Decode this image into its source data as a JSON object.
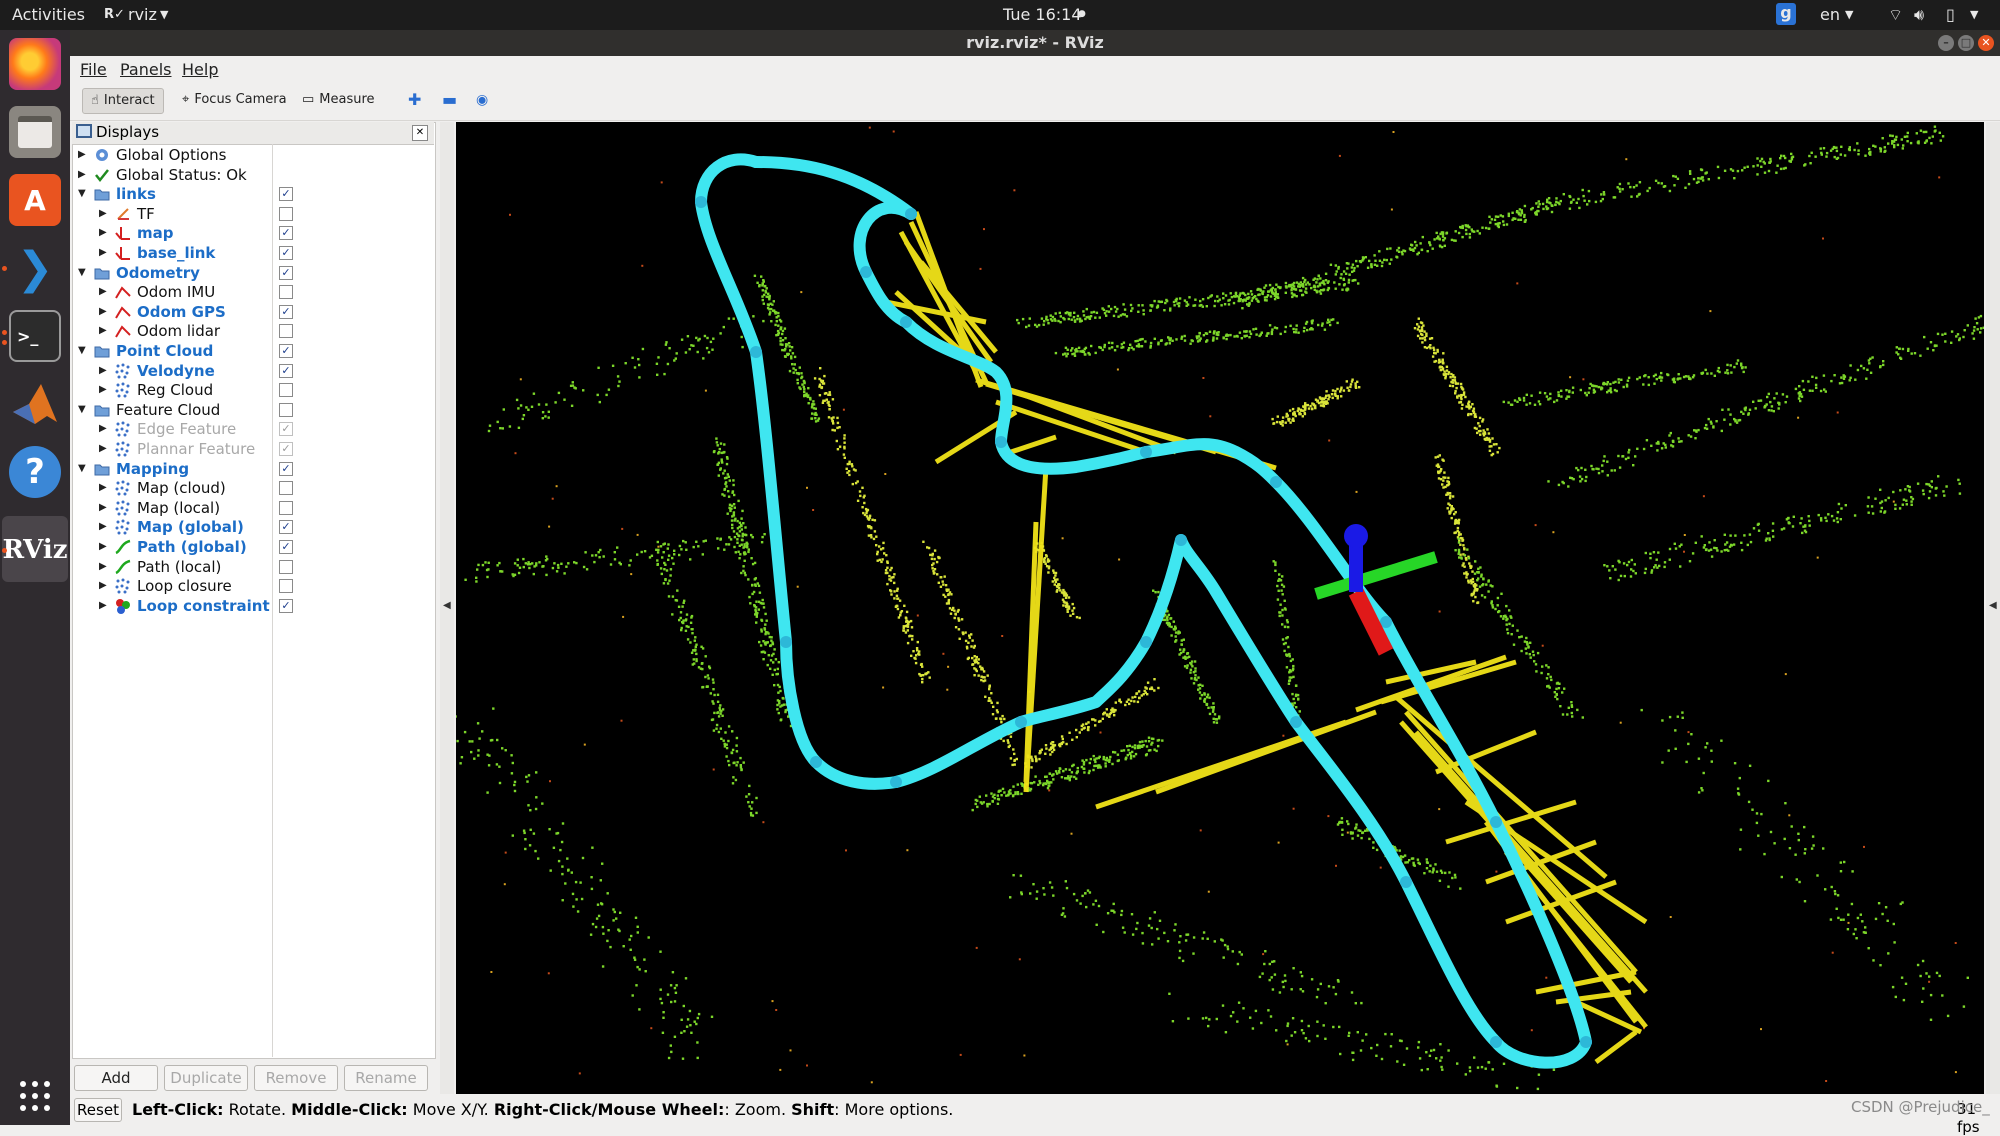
{
  "topbar": {
    "activities": "Activities",
    "app_name": "rviz",
    "clock": "Tue 16:14",
    "input_source": "en"
  },
  "dock": {
    "items": [
      "firefox-icon",
      "files-icon",
      "software-icon",
      "vscode-icon",
      "terminal-icon",
      "matlab-icon",
      "help-icon",
      "rviz-icon",
      "app-grid-icon"
    ]
  },
  "window": {
    "title": "rviz.rviz* - RViz"
  },
  "menu": {
    "file": "File",
    "panels": "Panels",
    "help": "Help"
  },
  "toolbar": {
    "interact": "Interact",
    "focus_camera": "Focus Camera",
    "measure": "Measure"
  },
  "displays": {
    "title": "Displays",
    "rows": [
      {
        "label": "Global Options",
        "indent": 0,
        "expanded": false,
        "icon": "gear",
        "checkbox": null,
        "state": "normal"
      },
      {
        "label": "Global Status: Ok",
        "indent": 0,
        "expanded": false,
        "icon": "check",
        "checkbox": null,
        "state": "normal"
      },
      {
        "label": "links",
        "indent": 0,
        "expanded": true,
        "icon": "folder",
        "checkbox": true,
        "state": "on"
      },
      {
        "label": "TF",
        "indent": 1,
        "expanded": false,
        "icon": "tf",
        "checkbox": false,
        "state": "normal"
      },
      {
        "label": "map",
        "indent": 1,
        "expanded": false,
        "icon": "axes",
        "checkbox": true,
        "state": "on"
      },
      {
        "label": "base_link",
        "indent": 1,
        "expanded": false,
        "icon": "axes",
        "checkbox": true,
        "state": "on"
      },
      {
        "label": "Odometry",
        "indent": 0,
        "expanded": true,
        "icon": "folder",
        "checkbox": true,
        "state": "on"
      },
      {
        "label": "Odom IMU",
        "indent": 1,
        "expanded": false,
        "icon": "odom",
        "checkbox": false,
        "state": "normal"
      },
      {
        "label": "Odom GPS",
        "indent": 1,
        "expanded": false,
        "icon": "odom",
        "checkbox": true,
        "state": "on"
      },
      {
        "label": "Odom lidar",
        "indent": 1,
        "expanded": false,
        "icon": "odom",
        "checkbox": false,
        "state": "normal"
      },
      {
        "label": "Point Cloud",
        "indent": 0,
        "expanded": true,
        "icon": "folder",
        "checkbox": true,
        "state": "on"
      },
      {
        "label": "Velodyne",
        "indent": 1,
        "expanded": false,
        "icon": "cloud",
        "checkbox": true,
        "state": "on"
      },
      {
        "label": "Reg Cloud",
        "indent": 1,
        "expanded": false,
        "icon": "cloud",
        "checkbox": false,
        "state": "normal"
      },
      {
        "label": "Feature Cloud",
        "indent": 0,
        "expanded": true,
        "icon": "folder",
        "checkbox": false,
        "state": "normal"
      },
      {
        "label": "Edge Feature",
        "indent": 1,
        "expanded": false,
        "icon": "cloud",
        "checkbox": "dim",
        "state": "dim"
      },
      {
        "label": "Plannar Feature",
        "indent": 1,
        "expanded": false,
        "icon": "cloud",
        "checkbox": "dim",
        "state": "dim"
      },
      {
        "label": "Mapping",
        "indent": 0,
        "expanded": true,
        "icon": "folder",
        "checkbox": true,
        "state": "on"
      },
      {
        "label": "Map (cloud)",
        "indent": 1,
        "expanded": false,
        "icon": "cloud",
        "checkbox": false,
        "state": "normal"
      },
      {
        "label": "Map (local)",
        "indent": 1,
        "expanded": false,
        "icon": "cloud",
        "checkbox": false,
        "state": "normal"
      },
      {
        "label": "Map (global)",
        "indent": 1,
        "expanded": false,
        "icon": "cloud",
        "checkbox": true,
        "state": "on"
      },
      {
        "label": "Path (global)",
        "indent": 1,
        "expanded": false,
        "icon": "path",
        "checkbox": true,
        "state": "on"
      },
      {
        "label": "Path (local)",
        "indent": 1,
        "expanded": false,
        "icon": "path",
        "checkbox": false,
        "state": "normal"
      },
      {
        "label": "Loop closure",
        "indent": 1,
        "expanded": false,
        "icon": "cloud",
        "checkbox": false,
        "state": "normal"
      },
      {
        "label": "Loop constraint",
        "indent": 1,
        "expanded": false,
        "icon": "marker",
        "checkbox": true,
        "state": "on"
      }
    ],
    "buttons": {
      "add": "Add",
      "duplicate": "Duplicate",
      "remove": "Remove",
      "rename": "Rename"
    }
  },
  "statusbar": {
    "reset": "Reset",
    "hint_leftclick_key": "Left-Click:",
    "hint_leftclick": " Rotate. ",
    "hint_middle_key": "Middle-Click:",
    "hint_middle": " Move X/Y. ",
    "hint_right_key": "Right-Click/Mouse Wheel:",
    "hint_right": ": Zoom. ",
    "hint_shift_key": "Shift",
    "hint_shift": ": More options.",
    "fps": "31 fps",
    "watermark": "CSDN @Prejudice_"
  },
  "colors": {
    "path": "#3fe6f0",
    "loop_constraint": "#f2e419",
    "cloud_green": "#7cd62a",
    "cloud_yellow": "#d9e43a",
    "axis_x": "#e01919",
    "axis_y": "#27d627",
    "axis_z": "#1a1ae6"
  }
}
